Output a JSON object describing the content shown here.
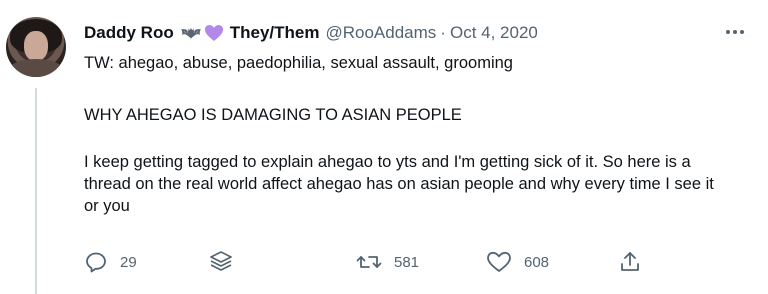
{
  "tweet": {
    "display_name": "Daddy Roo",
    "pronouns": "They/Them",
    "handle": "@RooAddams",
    "separator": "·",
    "date": "Oct 4, 2020",
    "more_icon": "more-horizontal-icon",
    "emoji": [
      "bat-emoji",
      "purple-heart-emoji"
    ],
    "text": {
      "tw_line": "TW: ahegao, abuse, paedophilia, sexual assault, grooming",
      "heading": "WHY AHEGAO IS DAMAGING TO ASIAN PEOPLE",
      "paragraph": "I keep getting tagged to explain ahegao to yts and I'm getting sick of it. So here is a thread on the real world affect ahegao has on asian people and why every time I see it or you"
    },
    "actions": {
      "reply": {
        "icon": "reply-icon",
        "count": "29"
      },
      "retweet_menu": {
        "icon": "layers-icon"
      },
      "retweet": {
        "icon": "retweet-icon",
        "count": "581"
      },
      "like": {
        "icon": "heart-icon",
        "count": "608"
      },
      "share": {
        "icon": "share-icon"
      }
    },
    "colors": {
      "text": "#0f1419",
      "muted": "#536471",
      "heart_emoji": "#b388eb",
      "thread_line": "#cfd9de"
    }
  }
}
